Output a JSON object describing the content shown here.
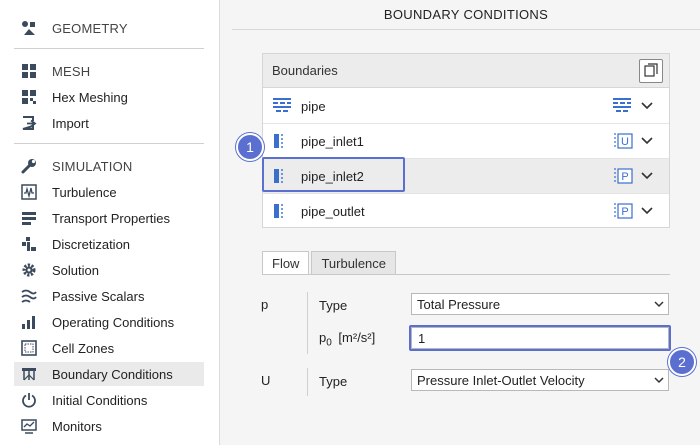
{
  "sidebar": {
    "items": [
      {
        "id": "geometry",
        "label": "GEOMETRY",
        "icon": "geometry-icon"
      },
      {
        "id": "mesh",
        "label": "MESH",
        "icon": "mesh-icon"
      },
      {
        "id": "hex-meshing",
        "label": "Hex Meshing",
        "icon": "hex-meshing-icon"
      },
      {
        "id": "import",
        "label": "Import",
        "icon": "import-icon"
      },
      {
        "id": "simulation",
        "label": "SIMULATION",
        "icon": "wrench-icon"
      },
      {
        "id": "turbulence",
        "label": "Turbulence",
        "icon": "turbulence-icon"
      },
      {
        "id": "transport-properties",
        "label": "Transport Properties",
        "icon": "transport-icon"
      },
      {
        "id": "discretization",
        "label": "Discretization",
        "icon": "discretization-icon"
      },
      {
        "id": "solution",
        "label": "Solution",
        "icon": "gear-icon"
      },
      {
        "id": "passive-scalars",
        "label": "Passive Scalars",
        "icon": "passive-scalars-icon"
      },
      {
        "id": "operating-conditions",
        "label": "Operating Conditions",
        "icon": "bar-chart-icon"
      },
      {
        "id": "cell-zones",
        "label": "Cell Zones",
        "icon": "cell-zones-icon"
      },
      {
        "id": "boundary-conditions",
        "label": "Boundary Conditions",
        "icon": "boundary-icon",
        "active": true
      },
      {
        "id": "initial-conditions",
        "label": "Initial Conditions",
        "icon": "power-icon"
      },
      {
        "id": "monitors",
        "label": "Monitors",
        "icon": "monitor-icon"
      }
    ]
  },
  "main": {
    "title": "BOUNDARY CONDITIONS",
    "boundaries": {
      "header": "Boundaries",
      "rows": [
        {
          "name": "pipe",
          "type_badge": "",
          "icon": "wall-icon"
        },
        {
          "name": "pipe_inlet1",
          "type_badge": "U",
          "icon": "patch-icon"
        },
        {
          "name": "pipe_inlet2",
          "type_badge": "P",
          "icon": "patch-icon",
          "selected": true
        },
        {
          "name": "pipe_outlet",
          "type_badge": "P",
          "icon": "patch-icon"
        }
      ]
    },
    "tabs": [
      {
        "label": "Flow",
        "active": true
      },
      {
        "label": "Turbulence",
        "active": false
      }
    ],
    "form": {
      "p_label": "p",
      "type_label": "Type",
      "p_type_value": "Total Pressure",
      "p0_label_main": "p",
      "p0_label_sub": "0",
      "p0_label_unit": "[m²/s²]",
      "p0_value": "1",
      "u_label": "U",
      "u_type_label": "Type",
      "u_type_value": "Pressure Inlet-Outlet Velocity"
    },
    "steps": [
      "1",
      "2"
    ]
  },
  "colors": {
    "accent": "#5b6fd1",
    "icon_blue": "#3a6fd0",
    "icon_dark": "#3b4a5c"
  }
}
